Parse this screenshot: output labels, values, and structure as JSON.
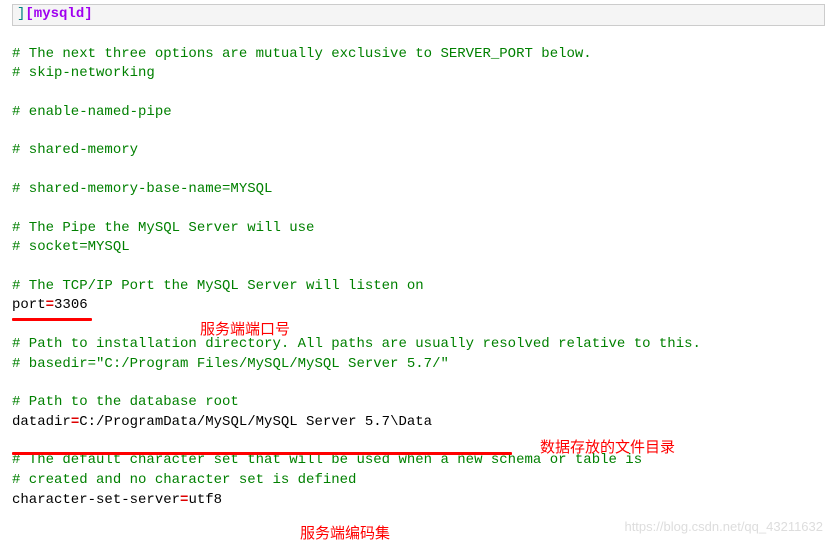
{
  "header": {
    "close": "]",
    "section": "[mysqld]"
  },
  "lines": {
    "c1": "# The next three options are mutually exclusive to SERVER_PORT below.",
    "c2": "# skip-networking",
    "c3": "# enable-named-pipe",
    "c4": "# shared-memory",
    "c5": "# shared-memory-base-name=MYSQL",
    "c6": "# The Pipe the MySQL Server will use",
    "c7": "# socket=MYSQL",
    "c8": "# The TCP/IP Port the MySQL Server will listen on",
    "port_key": "port",
    "port_val": "3306",
    "c9": "# Path to installation directory. All paths are usually resolved relative to this.",
    "c10": "# basedir=\"C:/Program Files/MySQL/MySQL Server 5.7/\"",
    "c11": "# Path to the database root",
    "datadir_key": "datadir",
    "datadir_val": "C:/ProgramData/MySQL/MySQL Server 5.7\\Data",
    "c12": "# The default character set that will be used when a new schema or table is",
    "c13": "# created and no character set is defined",
    "cs_key": "character-set-server",
    "cs_val": "utf8"
  },
  "annotations": {
    "port": "服务端端口号",
    "datadir": "数据存放的文件目录",
    "charset": "服务端编码集"
  },
  "watermark": "https://blog.csdn.net/qq_43211632"
}
